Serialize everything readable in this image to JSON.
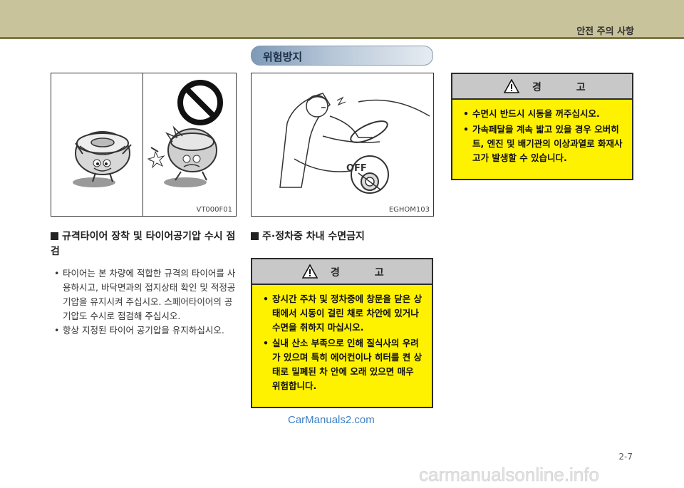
{
  "header": {
    "section_title": "안전 주의 사항"
  },
  "title_pill": {
    "label": "위험방지"
  },
  "left_figure": {
    "code": "VT000F01"
  },
  "right_figure": {
    "code": "EGHOM103",
    "off_label": "OFF"
  },
  "tire_section": {
    "heading": "규격타이어 장착 및 타이어공기압 수시 점검",
    "bullets": [
      "타이어는 본 차량에 적합한 규격의 타이어를 사용하시고, 바닥면과의 접지상태 확인 및 적정공기압을 유지시켜 주십시오. 스페어타이어의 공기압도 수시로 점검해 주십시오.",
      "항상 지정된 타이어 공기압을 유지하십시오."
    ]
  },
  "sleep_section": {
    "heading": "주·정차중 차내 수면금지",
    "warning": {
      "title": "경 고",
      "bullets": [
        "장시간 주차 및 정차중에 창문을 닫은 상태에서 시동이 걸린 채로 차안에 있거나 수면을 취하지 마십시오.",
        "실내 산소 부족으로 인해 질식사의 우려가 있으며 특히 에어컨이나 히터를 켠 상태로 밀폐된 차 안에 오래 있으면 매우 위험합니다."
      ]
    }
  },
  "top_warning": {
    "title": "경 고",
    "bullets": [
      "수면시 반드시 시동을 꺼주십시오.",
      "가속페달을 계속 밟고 있을 경우 오버히트, 엔진 및 배기관의 이상과열로 화재사고가 발생할 수 있습니다."
    ]
  },
  "watermark": "CarManuals2.com",
  "page_number": "2-7",
  "footer_watermark": "carmanualsonline.info"
}
